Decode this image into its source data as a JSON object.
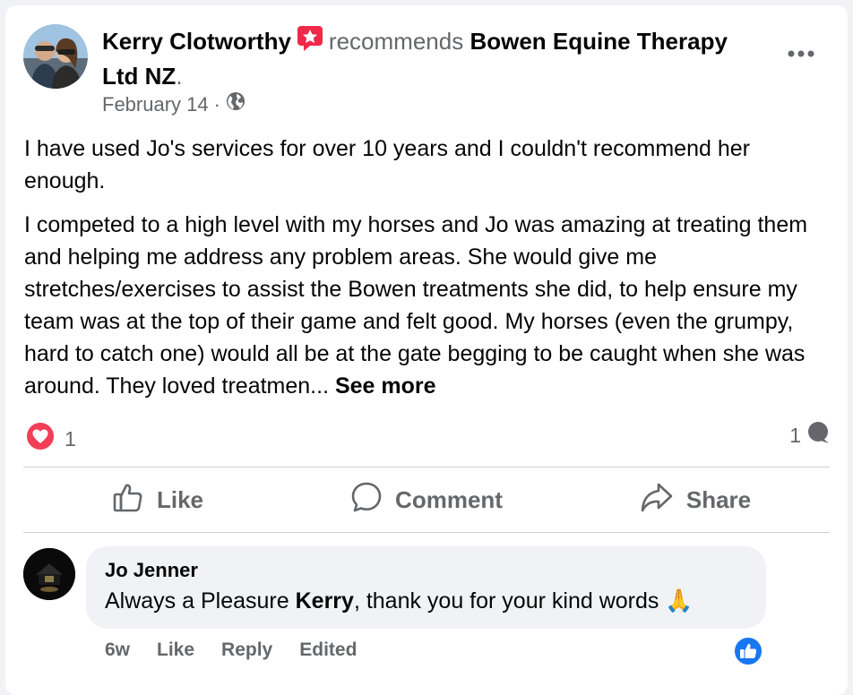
{
  "post": {
    "author": "Kerry Clotworthy",
    "verb": "recommends",
    "page_name": "Bowen Equine Therapy Ltd NZ",
    "period": ".",
    "date": "February 14",
    "separator": "·",
    "audience_icon": "globe-icon",
    "menu_icon": "more-horizontal-icon",
    "paragraph1": "I have used Jo's services for over 10 years and I couldn't recommend her enough.",
    "paragraph2": "I competed to a high level with my horses and Jo was amazing at treating them and helping me address any problem areas. She would give me stretches/exercises to assist the Bowen treatments she did, to help ensure my team was at the top of their game and felt good. My horses (even the grumpy, hard to catch one) would all be at the gate begging to be caught when she was around. They loved treatmen...",
    "see_more": "See more"
  },
  "stats": {
    "reaction_icon": "heart-reaction-icon",
    "reaction_count": "1",
    "comment_count": "1",
    "comment_icon": "comment-bubble-icon"
  },
  "actions": {
    "like": "Like",
    "comment": "Comment",
    "share": "Share"
  },
  "comment": {
    "author": "Jo Jenner",
    "text_before": "Always a Pleasure ",
    "mention": "Kerry",
    "text_after": ", thank you for your kind words ",
    "emoji": "🙏",
    "age": "6w",
    "like": "Like",
    "reply": "Reply",
    "edited": "Edited",
    "reaction_icon": "like-reaction-icon"
  },
  "colors": {
    "text": "#050505",
    "muted": "#65676b",
    "link_blue": "#1877f2",
    "heart_red": "#f33e58",
    "recommend_badge": "#f02849",
    "bubble_bg": "#f0f2f5"
  }
}
